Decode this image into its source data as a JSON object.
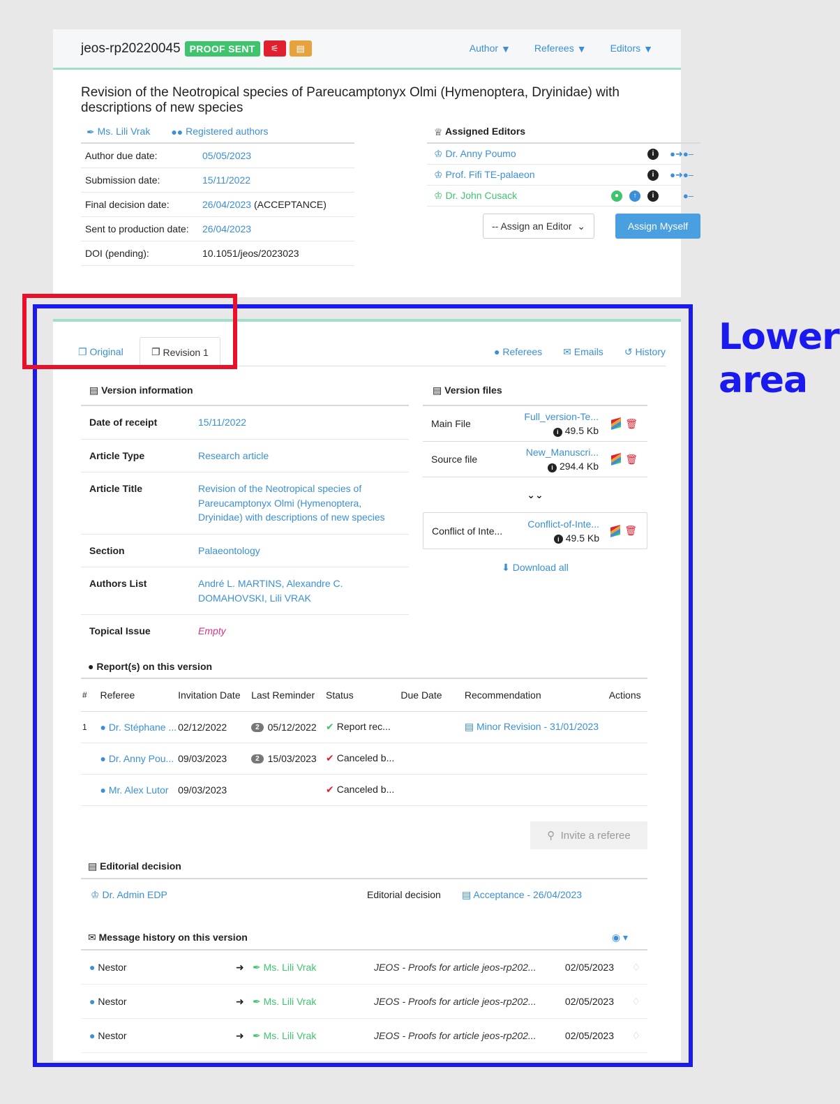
{
  "header": {
    "manuscript_id": "jeos-rp20220045",
    "status_badge": "PROOF SENT",
    "nav": [
      "Author",
      "Referees",
      "Editors"
    ]
  },
  "article_title": "Revision of the Neotropical species of Pareucamptonyx Olmi (Hymenoptera, Dryinidae) with descriptions of new species",
  "author_links": {
    "author": "Ms. Lili Vrak",
    "registered": "Registered authors"
  },
  "meta": [
    {
      "label": "Author due date:",
      "value": "05/05/2023",
      "suffix": ""
    },
    {
      "label": "Submission date:",
      "value": "15/11/2022",
      "suffix": ""
    },
    {
      "label": "Final decision date:",
      "value": "26/04/2023",
      "suffix": " (ACCEPTANCE)"
    },
    {
      "label": "Sent to production date:",
      "value": "26/04/2023",
      "suffix": ""
    },
    {
      "label": "DOI (pending):",
      "value": "10.1051/jeos/2023023",
      "suffix": ""
    }
  ],
  "assigned_editors": {
    "title": "Assigned Editors",
    "editors": [
      "Dr. Anny Poumo",
      "Prof. Fifi TE-palaeon",
      "Dr. John Cusack"
    ],
    "select_placeholder": "-- Assign an Editor",
    "assign_myself": "Assign Myself"
  },
  "tabs": {
    "original": "Original",
    "revision": "Revision 1",
    "right": [
      "Referees",
      "Emails",
      "History"
    ]
  },
  "version_info": {
    "title": "Version information",
    "rows": [
      {
        "k": "Date of receipt",
        "v": "15/11/2022"
      },
      {
        "k": "Article Type",
        "v": "Research article"
      },
      {
        "k": "Article Title",
        "v": "Revision of the Neotropical species of Pareucamptonyx Olmi (Hymenoptera, Dryinidae) with descriptions of new species"
      },
      {
        "k": "Section",
        "v": "Palaeontology"
      },
      {
        "k": "Authors List",
        "v": "André L. MARTINS, Alexandre C. DOMAHOVSKI, Lili VRAK"
      },
      {
        "k": "Topical Issue",
        "v": "Empty"
      }
    ]
  },
  "version_files": {
    "title": "Version files",
    "files": [
      {
        "label": "Main File",
        "name": "Full_version-Te...",
        "size": "49.5 Kb"
      },
      {
        "label": "Source file",
        "name": "New_Manuscri...",
        "size": "294.4 Kb"
      }
    ],
    "extra": {
      "label": "Conflict of Inte...",
      "name": "Conflict-of-Inte...",
      "size": "49.5 Kb"
    },
    "download_all": "Download all"
  },
  "reports": {
    "title": "Report(s) on this version",
    "headers": [
      "#",
      "Referee",
      "Invitation Date",
      "Last Reminder",
      "Status",
      "Due Date",
      "Recommendation",
      "Actions"
    ],
    "rows": [
      {
        "num": "1",
        "referee": "Dr. Stéphane ...",
        "invited": "02/12/2022",
        "reminder_count": "2",
        "reminder": "05/12/2022",
        "status": "Report rec...",
        "status_ok": true,
        "recommendation": "Minor Revision - 31/01/2023"
      },
      {
        "num": "",
        "referee": "Dr. Anny Pou...",
        "invited": "09/03/2023",
        "reminder_count": "2",
        "reminder": "15/03/2023",
        "status": "Canceled b...",
        "status_ok": false,
        "recommendation": ""
      },
      {
        "num": "",
        "referee": "Mr. Alex Lutor",
        "invited": "09/03/2023",
        "reminder_count": "",
        "reminder": "",
        "status": "Canceled b...",
        "status_ok": false,
        "recommendation": ""
      }
    ],
    "invite_button": "Invite a referee"
  },
  "editorial_decision": {
    "title": "Editorial decision",
    "editor": "Dr. Admin EDP",
    "label": "Editorial decision",
    "decision": "Acceptance - 26/04/2023"
  },
  "messages": {
    "title": "Message history on this version",
    "rows": [
      {
        "from": "Nestor",
        "to": "Ms. Lili Vrak",
        "subject": "JEOS - Proofs for article jeos-rp202...",
        "date": "02/05/2023"
      },
      {
        "from": "Nestor",
        "to": "Ms. Lili Vrak",
        "subject": "JEOS - Proofs for article jeos-rp202...",
        "date": "02/05/2023"
      },
      {
        "from": "Nestor",
        "to": "Ms. Lili Vrak",
        "subject": "JEOS - Proofs for article jeos-rp202...",
        "date": "02/05/2023"
      }
    ]
  },
  "annotation": {
    "label": "Lower area"
  },
  "colors": {
    "link": "#3a8fd8",
    "accent_green": "#3ec46d",
    "annotation_blue": "#1a1aef",
    "annotation_red": "#e8102a"
  }
}
